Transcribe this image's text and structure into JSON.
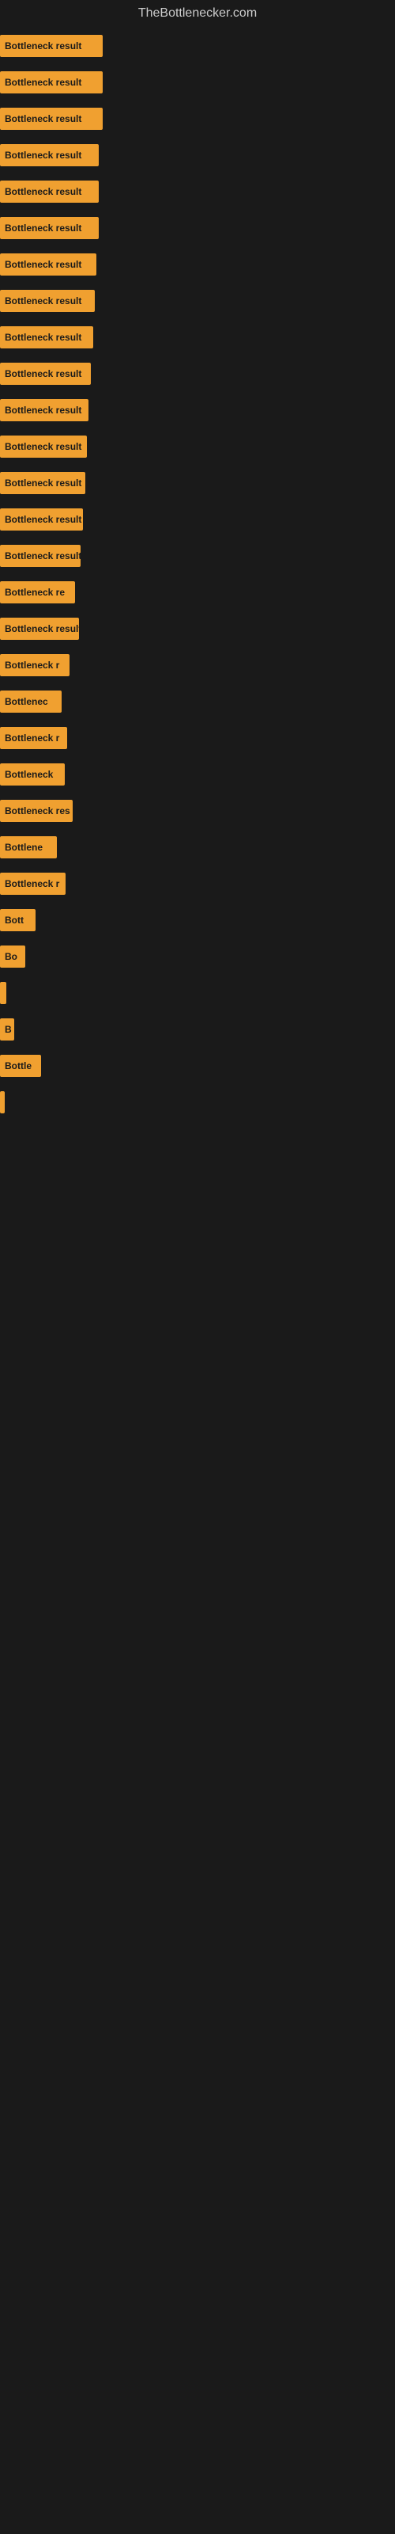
{
  "site": {
    "title": "TheBottlenecker.com"
  },
  "bars": [
    {
      "label": "Bottleneck result",
      "width": 130
    },
    {
      "label": "Bottleneck result",
      "width": 130
    },
    {
      "label": "Bottleneck result",
      "width": 130
    },
    {
      "label": "Bottleneck result",
      "width": 125
    },
    {
      "label": "Bottleneck result",
      "width": 125
    },
    {
      "label": "Bottleneck result",
      "width": 125
    },
    {
      "label": "Bottleneck result",
      "width": 122
    },
    {
      "label": "Bottleneck result",
      "width": 120
    },
    {
      "label": "Bottleneck result",
      "width": 118
    },
    {
      "label": "Bottleneck result",
      "width": 115
    },
    {
      "label": "Bottleneck result",
      "width": 112
    },
    {
      "label": "Bottleneck result",
      "width": 110
    },
    {
      "label": "Bottleneck result",
      "width": 108
    },
    {
      "label": "Bottleneck result",
      "width": 105
    },
    {
      "label": "Bottleneck result",
      "width": 102
    },
    {
      "label": "Bottleneck re",
      "width": 95
    },
    {
      "label": "Bottleneck result",
      "width": 100
    },
    {
      "label": "Bottleneck r",
      "width": 88
    },
    {
      "label": "Bottlenec",
      "width": 78
    },
    {
      "label": "Bottleneck r",
      "width": 85
    },
    {
      "label": "Bottleneck",
      "width": 82
    },
    {
      "label": "Bottleneck res",
      "width": 92
    },
    {
      "label": "Bottlene",
      "width": 72
    },
    {
      "label": "Bottleneck r",
      "width": 83
    },
    {
      "label": "Bott",
      "width": 45
    },
    {
      "label": "Bo",
      "width": 32
    },
    {
      "label": "",
      "width": 8
    },
    {
      "label": "B",
      "width": 18
    },
    {
      "label": "Bottle",
      "width": 52
    },
    {
      "label": "",
      "width": 6
    }
  ]
}
